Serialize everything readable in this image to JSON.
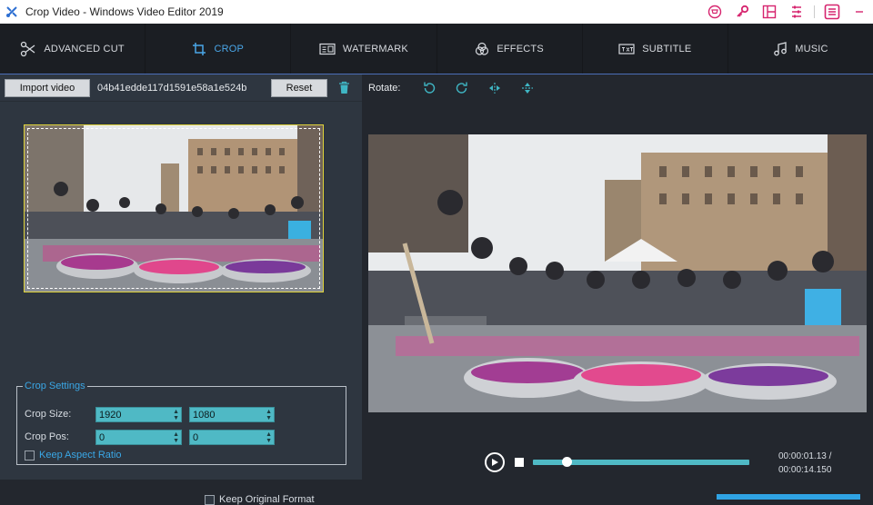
{
  "window": {
    "title": "Crop Video - Windows Video Editor 2019"
  },
  "nav": {
    "tabs": [
      {
        "label": "ADVANCED CUT",
        "icon": "scissors-icon"
      },
      {
        "label": "CROP",
        "icon": "crop-icon",
        "active": true
      },
      {
        "label": "WATERMARK",
        "icon": "watermark-icon"
      },
      {
        "label": "EFFECTS",
        "icon": "effects-icon"
      },
      {
        "label": "SUBTITLE",
        "icon": "subtitle-icon"
      },
      {
        "label": "MUSIC",
        "icon": "music-icon"
      }
    ]
  },
  "left": {
    "import_label": "Import video",
    "file_name": "04b41edde117d1591e58a1e524b",
    "reset_label": "Reset",
    "crop_settings": {
      "legend": "Crop Settings",
      "size_label": "Crop Size:",
      "pos_label": "Crop Pos:",
      "width": "1920",
      "height": "1080",
      "pos_x": "0",
      "pos_y": "0",
      "keep_aspect_label": "Keep Aspect Ratio"
    }
  },
  "right": {
    "rotate_label": "Rotate:",
    "current_time": "00:00:01.13 /",
    "total_time": "00:00:14.150",
    "progress": 0.14
  },
  "footer": {
    "keep_original_label": "Keep Original Format"
  },
  "colors": {
    "accent": "#3aa7e6",
    "spin_fill": "#4fb9c5",
    "crop_border": "#e0d43a",
    "title_icons": "#d6246e"
  }
}
